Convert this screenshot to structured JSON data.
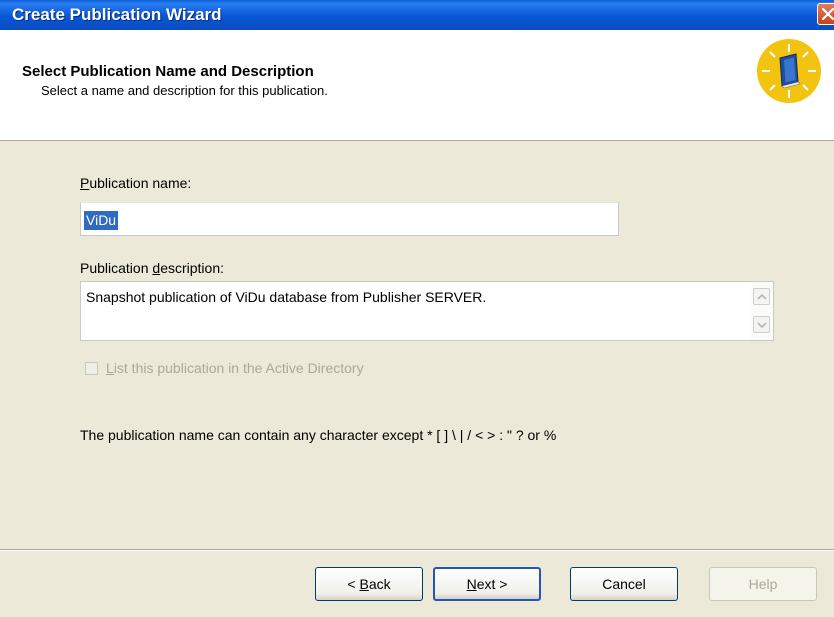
{
  "window": {
    "title": "Create Publication Wizard"
  },
  "header": {
    "title": "Select Publication Name and Description",
    "subtitle": "Select a name and description for this publication.",
    "icon": "publication-book-icon"
  },
  "form": {
    "name_label_accel": "P",
    "name_label_rest": "ublication name:",
    "name_value": "ViDu",
    "desc_label_pre": "Publication ",
    "desc_label_accel": "d",
    "desc_label_post": "escription:",
    "desc_value": "Snapshot publication of ViDu database from Publisher SERVER.",
    "active_directory_accel": "L",
    "active_directory_rest": "ist this publication in the Active Directory",
    "active_directory_checked": false,
    "note": "The publication name can contain any character except * [ ] \\ | / < > : \" ? or %"
  },
  "buttons": {
    "back_pre": "< ",
    "back_accel": "B",
    "back_post": "ack",
    "next_accel": "N",
    "next_post": "ext >",
    "cancel": "Cancel",
    "help": "Help"
  },
  "colors": {
    "titlebar": "#0a5fd8",
    "selection": "#316ac5",
    "dialog_bg": "#ece9d8"
  }
}
